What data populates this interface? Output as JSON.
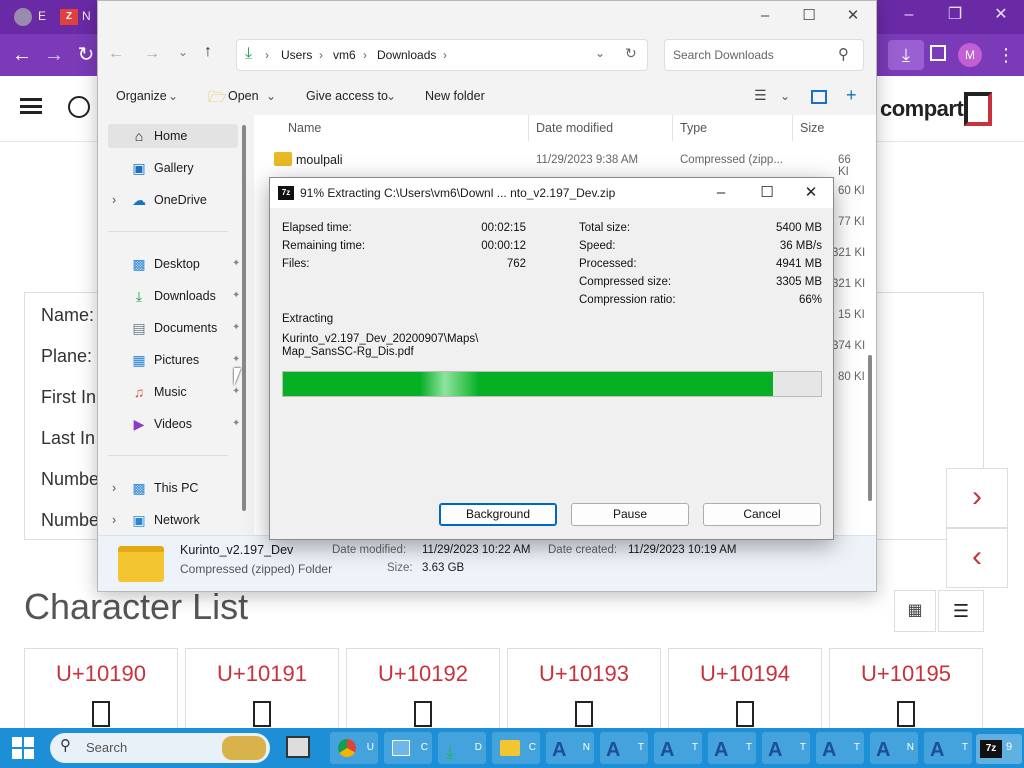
{
  "browser": {
    "tabs": [
      {
        "label": "E"
      },
      {
        "label": "N"
      }
    ],
    "profile_initial": "M"
  },
  "site": {
    "logo": "compart",
    "info_labels": [
      "Name:",
      "Plane:",
      "First In",
      "Last In",
      "Numbe",
      "Numbe"
    ],
    "character_list_title": "Character List",
    "cards": [
      "U+10190",
      "U+10191",
      "U+10192",
      "U+10193",
      "U+10194",
      "U+10195"
    ]
  },
  "explorer": {
    "breadcrumb": [
      "Users",
      "vm6",
      "Downloads"
    ],
    "search_placeholder": "Search Downloads",
    "commands": {
      "organize": "Organize",
      "open": "Open",
      "give_access": "Give access to",
      "new_folder": "New folder"
    },
    "nav": [
      {
        "label": "Home",
        "icon": "home-icon"
      },
      {
        "label": "Gallery",
        "icon": "gallery-icon"
      },
      {
        "label": "OneDrive",
        "icon": "cloud-icon"
      },
      {
        "label": "Desktop",
        "icon": "desktop-icon"
      },
      {
        "label": "Downloads",
        "icon": "download-icon"
      },
      {
        "label": "Documents",
        "icon": "documents-icon"
      },
      {
        "label": "Pictures",
        "icon": "pictures-icon"
      },
      {
        "label": "Music",
        "icon": "music-icon"
      },
      {
        "label": "Videos",
        "icon": "videos-icon"
      },
      {
        "label": "This PC",
        "icon": "pc-icon"
      },
      {
        "label": "Network",
        "icon": "network-icon"
      }
    ],
    "columns": {
      "name": "Name",
      "date": "Date modified",
      "type": "Type",
      "size": "Size"
    },
    "file_row": {
      "name": "moulpali",
      "date": "11/29/2023 9:38 AM",
      "type": "Compressed (zipp...",
      "size": "66 KI"
    },
    "size_fragments": [
      "60 KI",
      "77 KI",
      "321 KI",
      "321 KI",
      "15 KI",
      "374 KI",
      "80 KI"
    ],
    "details": {
      "name": "Kurinto_v2.197_Dev",
      "kind": "Compressed (zipped) Folder",
      "date_modified_label": "Date modified:",
      "date_modified": "11/29/2023 10:22 AM",
      "date_created_label": "Date created:",
      "date_created": "11/29/2023 10:19 AM",
      "size_label": "Size:",
      "size": "3.63 GB"
    }
  },
  "zip_dialog": {
    "title": "91% Extracting C:\\Users\\vm6\\Downl ... nto_v2.197_Dev.zip",
    "left_stats": [
      {
        "label": "Elapsed time:",
        "value": "00:02:15"
      },
      {
        "label": "Remaining time:",
        "value": "00:00:12"
      },
      {
        "label": "Files:",
        "value": "762"
      }
    ],
    "right_stats": [
      {
        "label": "Total size:",
        "value": "5400 MB"
      },
      {
        "label": "Speed:",
        "value": "36 MB/s"
      },
      {
        "label": "Processed:",
        "value": "4941 MB"
      },
      {
        "label": "Compressed size:",
        "value": "3305 MB"
      },
      {
        "label": "Compression ratio:",
        "value": "66%"
      }
    ],
    "extracting_label": "Extracting",
    "path_line1": "Kurinto_v2.197_Dev_20200907\\Maps\\",
    "path_line2": "Map_SansSC-Rg_Dis.pdf",
    "progress_percent": 91,
    "buttons": {
      "background": "Background",
      "pause": "Pause",
      "cancel": "Cancel"
    }
  },
  "taskbar": {
    "search_placeholder": "Search",
    "apps": [
      "U",
      "C",
      "D",
      "C",
      "N",
      "T",
      "T",
      "T",
      "T",
      "T",
      "N",
      "T"
    ],
    "tray_label": "9"
  },
  "colors": {
    "browser_purple": "#7b3bb8",
    "progress_green": "#06b025",
    "accent_red": "#c8323c",
    "taskbar_blue": "#1c8fd6"
  }
}
